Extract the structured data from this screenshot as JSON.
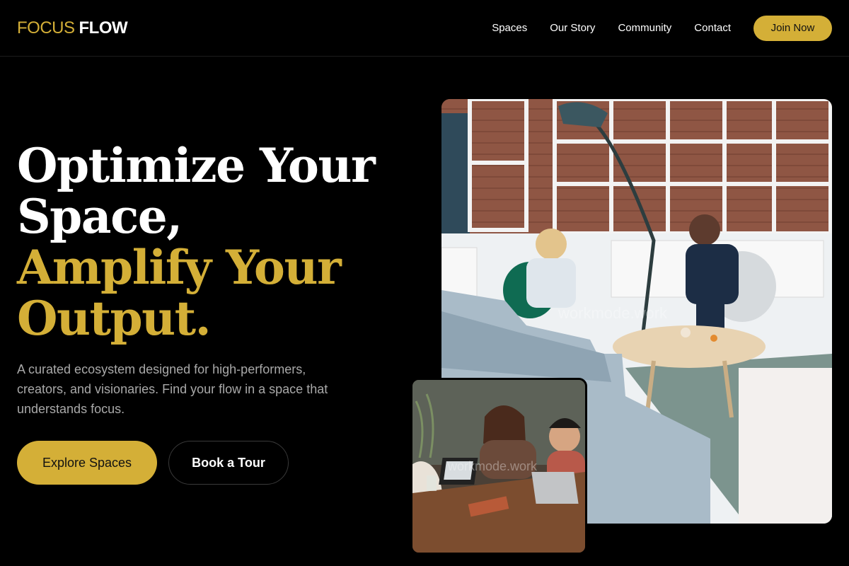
{
  "header": {
    "logo_part1": "FOCUS",
    "logo_part2": "FLOW",
    "nav": [
      "Spaces",
      "Our Story",
      "Community",
      "Contact"
    ],
    "join_label": "Join Now"
  },
  "hero": {
    "title_line1": "Optimize Your",
    "title_line2": "Space,",
    "title_line3": "Amplify Your",
    "title_line4": "Output.",
    "subtitle": "A curated ecosystem designed for high-performers, creators, and visionaries. Find your flow in a space that understands focus.",
    "primary_cta": "Explore Spaces",
    "secondary_cta": "Book a Tour"
  },
  "images": {
    "main_watermark": "workmode.work",
    "secondary_watermark": "workmode.work"
  },
  "colors": {
    "accent": "#D4AF37",
    "background": "#000000",
    "text_muted": "#A9A9A9"
  }
}
